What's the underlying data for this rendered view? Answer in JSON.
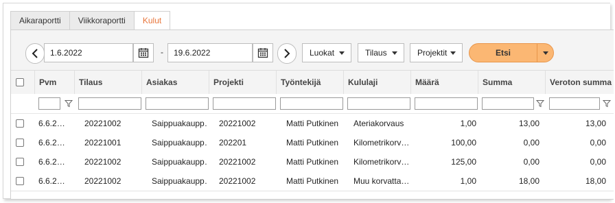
{
  "tabs": [
    {
      "label": "Aikaraportti",
      "active": false
    },
    {
      "label": "Viikkoraportti",
      "active": false
    },
    {
      "label": "Kulut",
      "active": true
    }
  ],
  "toolbar": {
    "start_date": "1.6.2022",
    "separator": "-",
    "end_date": "19.6.2022",
    "dropdowns": [
      "Luokat",
      "Tilaus",
      "Projektit"
    ],
    "search_label": "Etsi",
    "accent_color": "#fbb773"
  },
  "columns": [
    "Pvm",
    "Tilaus",
    "Asiakas",
    "Projekti",
    "Työntekijä",
    "Kululaji",
    "Määrä",
    "Summa",
    "Veroton summa"
  ],
  "rows": [
    [
      "6.6.2…",
      "20221002",
      "Saippuakaupp…",
      "20221002",
      "Matti Putkinen",
      "Ateriakorvaus",
      "1,00",
      "13,00",
      "13,00"
    ],
    [
      "6.6.2…",
      "20221001",
      "Saippuakaupp…",
      "202201",
      "Matti Putkinen",
      "Kilometrikorv…",
      "100,00",
      "0,00",
      "0,00"
    ],
    [
      "6.6.2…",
      "20221002",
      "Saippuakaupp…",
      "20221002",
      "Matti Putkinen",
      "Kilometrikorv…",
      "125,00",
      "0,00",
      "0,00"
    ],
    [
      "6.6.2…",
      "20221002",
      "Saippuakaupp…",
      "20221002",
      "Matti Putkinen",
      "Muu korvatta…",
      "1,00",
      "18,00",
      "18,00"
    ]
  ]
}
